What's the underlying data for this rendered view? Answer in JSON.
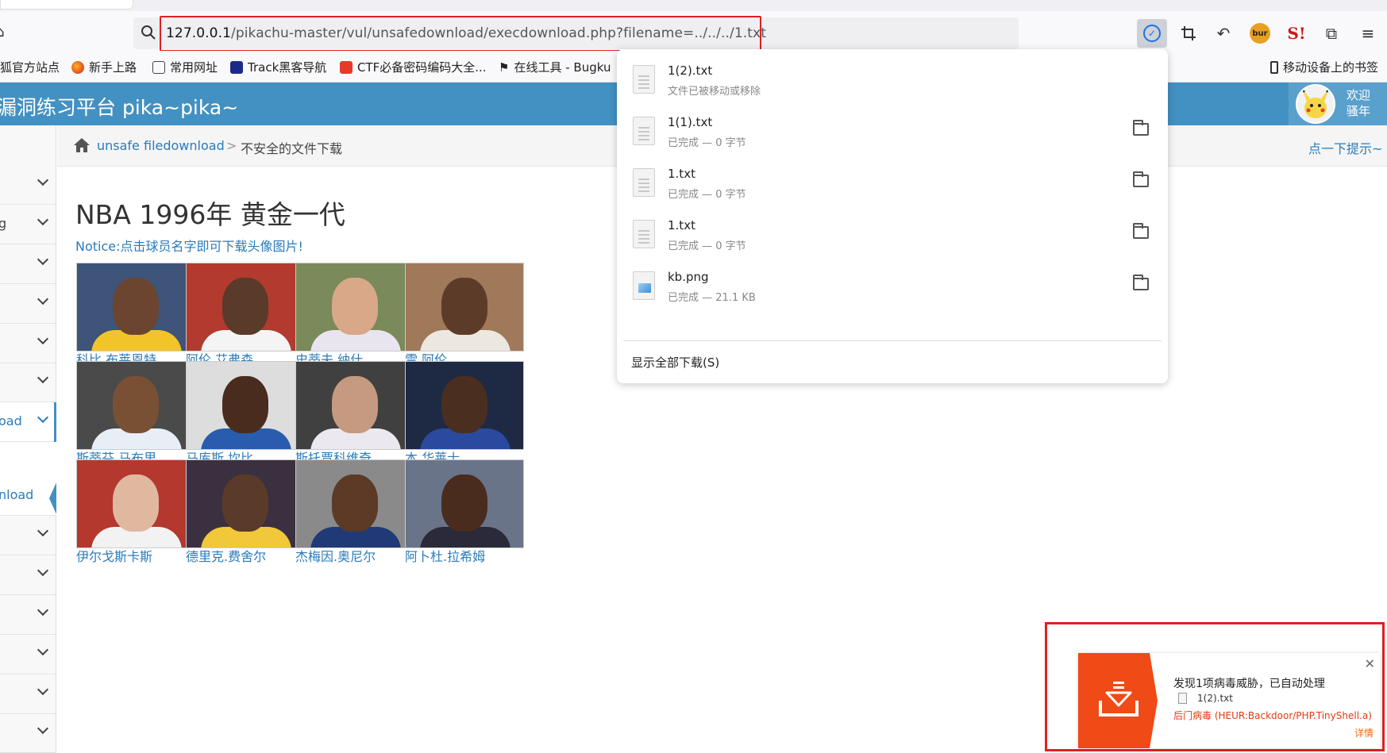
{
  "browser": {
    "url": {
      "host": "127.0.0.1",
      "path": "/pikachu-master/vul/unsafedownload/execdownload.php?filename=../../../1.txt"
    },
    "toolbar": {
      "download_icon": "download-icon",
      "burp_label": "bur",
      "sbadge_label": "S!"
    },
    "bookmarks": [
      {
        "label": "狐官方站点"
      },
      {
        "label": "新手上路"
      },
      {
        "label": "常用网址"
      },
      {
        "label": "Track黑客导航"
      },
      {
        "label": "CTF必备密码编码大全..."
      },
      {
        "label": "在线工具 - Bugku"
      }
    ],
    "mobile_bookmarks": "移动设备上的书签"
  },
  "site": {
    "title": "漏洞练习平台 pika~pika~",
    "user_greeting_1": "欢迎",
    "user_greeting_2": "骚年"
  },
  "sidebar": {
    "items": [
      {
        "label": ""
      },
      {
        "label": "g"
      },
      {
        "label": ""
      },
      {
        "label": ""
      },
      {
        "label": ""
      },
      {
        "label": ""
      },
      {
        "label": "oad"
      }
    ],
    "sub_item": "nload",
    "items_after": [
      {
        "label": ""
      },
      {
        "label": ""
      },
      {
        "label": ""
      },
      {
        "label": ""
      },
      {
        "label": ""
      },
      {
        "label": ""
      }
    ]
  },
  "breadcrumb": {
    "link": "unsafe filedownload",
    "separator": ">",
    "current": "不安全的文件下载",
    "tip": "点一下提示~"
  },
  "content": {
    "heading": "NBA 1996年 黄金一代",
    "notice": "Notice:点击球员名字即可下载头像图片!",
    "players": [
      {
        "name": "科比.布莱恩特",
        "skin": "#6b4530",
        "jersey": "#f3c42a",
        "bg": "#3e5478"
      },
      {
        "name": "阿伦.艾弗森",
        "skin": "#5a3a28",
        "jersey": "#f4f4f4",
        "bg": "#b23a2e"
      },
      {
        "name": "史蒂夫.纳什",
        "skin": "#d8a888",
        "jersey": "#e9e5f0",
        "bg": "#7a8a5a"
      },
      {
        "name": "雷.阿伦",
        "skin": "#5c3c28",
        "jersey": "#ece7df",
        "bg": "#a0785a"
      },
      {
        "name": "斯蒂芬.马布里",
        "skin": "#7a5034",
        "jersey": "#e8eef6",
        "bg": "#4a4a4a"
      },
      {
        "name": "马库斯.坎比",
        "skin": "#4a2c1e",
        "jersey": "#2a5cae",
        "bg": "#dddddd"
      },
      {
        "name": "斯托贾科维奇",
        "skin": "#c69a80",
        "jersey": "#ece8f0",
        "bg": "#404040"
      },
      {
        "name": "本.华莱士",
        "skin": "#4a2e20",
        "jersey": "#2a4aa0",
        "bg": "#1e2a44"
      },
      {
        "name": "伊尔戈斯卡斯",
        "skin": "#e0b8a0",
        "jersey": "#f2f2f2",
        "bg": "#b4382e"
      },
      {
        "name": "德里克.费舍尔",
        "skin": "#5a3a28",
        "jersey": "#f0c83a",
        "bg": "#3a3040"
      },
      {
        "name": "杰梅因.奥尼尔",
        "skin": "#5c3a26",
        "jersey": "#203a78",
        "bg": "#8a8a8a"
      },
      {
        "name": "阿卜杜.拉希姆",
        "skin": "#4a2c1e",
        "jersey": "#2a2a3a",
        "bg": "#6a7488"
      }
    ]
  },
  "downloads": {
    "items": [
      {
        "name": "1(2).txt",
        "status": "文件已被移动或移除",
        "type": "text",
        "has_folder": false
      },
      {
        "name": "1(1).txt",
        "status": "已完成 — 0 字节",
        "type": "text",
        "has_folder": true
      },
      {
        "name": "1.txt",
        "status": "已完成 — 0 字节",
        "type": "text",
        "has_folder": true
      },
      {
        "name": "1.txt",
        "status": "已完成 — 0 字节",
        "type": "text",
        "has_folder": true
      },
      {
        "name": "kb.png",
        "status": "已完成 — 21.1 KB",
        "type": "image",
        "has_folder": true
      }
    ],
    "show_all": "显示全部下载(S)"
  },
  "antivirus": {
    "title": "发现1项病毒威胁，已自动处理",
    "file": "1(2).txt",
    "threat": "后门病毒 (HEUR:Backdoor/PHP.TinyShell.a)",
    "detail": "详情",
    "accent": "#f04a16"
  }
}
